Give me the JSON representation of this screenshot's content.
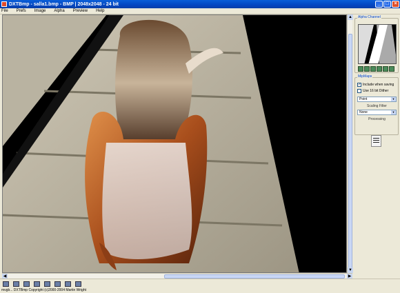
{
  "window": {
    "title": "DXTBmp - salla1.bmp - BMP | 2048x2048 - 24 bit"
  },
  "menu": [
    {
      "label": "File"
    },
    {
      "label": "Prefs"
    },
    {
      "label": "Image"
    },
    {
      "label": "Alpha"
    },
    {
      "label": "Preview"
    },
    {
      "label": "Help"
    }
  ],
  "panel": {
    "alpha_title": "Alpha Channel",
    "mipmaps_title": "MipMaps",
    "include_label": "Include when saving",
    "include_checked": true,
    "dither_label": "Use 16 bit Dither",
    "dither_checked": false,
    "filter_value": "Point",
    "filter_caption": "Scaling Filter",
    "processing_value": "None",
    "processing_caption": "Processing"
  },
  "status": {
    "text": "mvgb... DXTBmp Copyright (c)2000-2004 Martin Wright"
  },
  "toolbar": {
    "icons": [
      "open-icon",
      "save-icon",
      "copy-icon",
      "paste-icon",
      "print-icon",
      "flip-vertical-icon",
      "flip-horizontal-icon",
      "zoom-icon"
    ]
  },
  "colors": {
    "title_bar": "#0447c2",
    "panel_bg": "#ece9d8",
    "group_title": "#0046d5"
  }
}
